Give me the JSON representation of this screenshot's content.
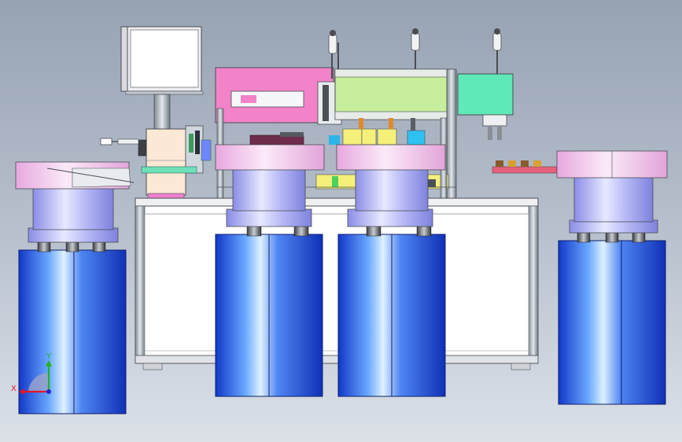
{
  "viewport": {
    "background_top": "#97a2b3",
    "background_bottom": "#dce1e8"
  },
  "triad": {
    "x_label": "X",
    "y_label": "Y",
    "x_color": "#e0162b",
    "y_color": "#1fb51f",
    "z_color": "#1c2ad6"
  },
  "colors": {
    "bowl_blue": "#1e49d8",
    "bowl_lilac": "#b6b8f2",
    "ring_pink": "#f2c6ea",
    "frame_white": "#ffffff",
    "panel_pink": "#f07cc6",
    "panel_green": "#c4ec9a",
    "panel_cyan": "#5ee8b8",
    "beige": "#fae8d2",
    "yellow": "#f4f07a",
    "maroon": "#6e2b4a"
  },
  "components": [
    "monitor",
    "frame-table",
    "vibratory-feeder-left",
    "vibratory-feeder-center-left",
    "vibratory-feeder-center-right",
    "vibratory-feeder-right",
    "pneumatic-cylinder-left",
    "pneumatic-cylinder-middle",
    "pneumatic-cylinder-right",
    "pink-slide-unit",
    "green-gantry-beam",
    "cyan-gripper-head",
    "part-conveyor-right"
  ]
}
